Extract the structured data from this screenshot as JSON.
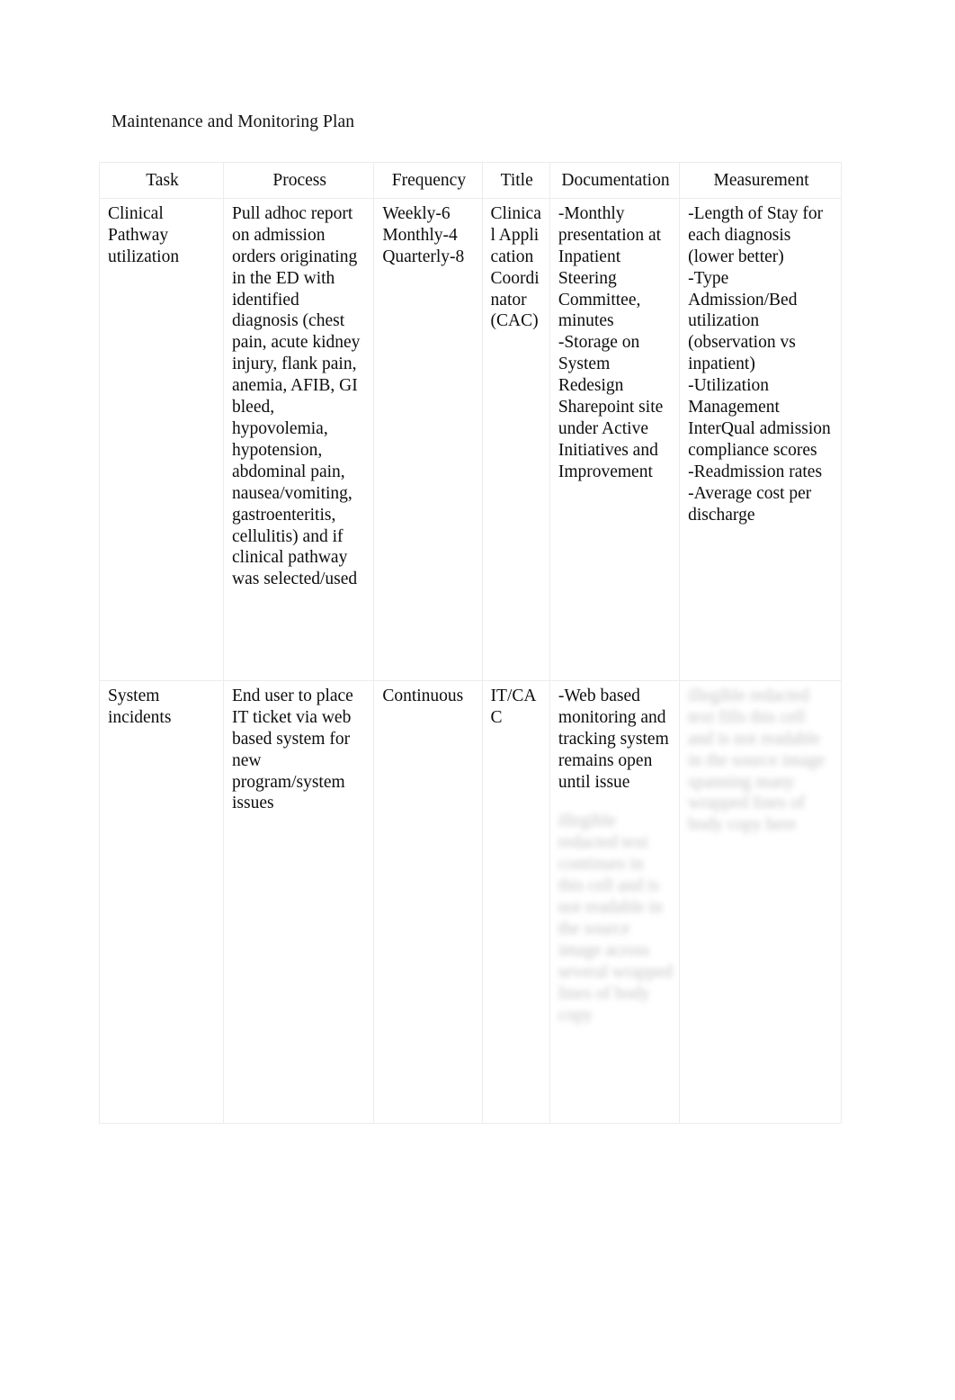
{
  "document": {
    "title": "Maintenance and Monitoring Plan",
    "background_color": "#ffffff",
    "text_color": "#0d0d0d",
    "border_color": "#ececed"
  },
  "table": {
    "headers": [
      "Task",
      "Process",
      "Frequency",
      "Title",
      "Documentation",
      "Measurement"
    ],
    "rows": [
      {
        "task": "Clinical Pathway utilization",
        "process": "Pull adhoc report on admission orders originating in the ED with identified diagnosis (chest pain, acute kidney injury, flank pain, anemia, AFIB, GI bleed, hypovolemia, hypotension, abdominal pain, nausea/vomiting, gastroenteritis, cellulitis) and if clinical pathway was selected/used",
        "frequency": "Weekly-6\nMonthly-4\nQuarterly-8",
        "title": "Clinical Application Coordinator (CAC)",
        "documentation": "-Monthly presentation at  Inpatient Steering Committee, minutes\n-Storage on System Redesign Sharepoint site under Active Initiatives and Improvement",
        "measurement": "-Length of Stay for each diagnosis (lower better)\n-Type Admission/Bed utilization (observation vs inpatient)\n-Utilization Management InterQual admission compliance scores\n-Readmission rates\n-Average cost per discharge",
        "redacted": {
          "documentation": false,
          "measurement": false
        }
      },
      {
        "task": "System incidents",
        "process": "End user to place IT ticket via web based system for new program/system issues",
        "frequency": "Continuous",
        "title": "IT/CAC",
        "documentation": "-Web based monitoring and tracking system remains open until issue",
        "documentation_redacted": "illegible redacted text continues in this cell and is not readable in the source image across several wrapped lines of body copy",
        "measurement": "",
        "measurement_redacted": "illegible redacted text fills this cell and is not readable in the source image spanning many wrapped lines of body copy here",
        "redacted": {
          "documentation": true,
          "measurement": true
        }
      }
    ]
  }
}
